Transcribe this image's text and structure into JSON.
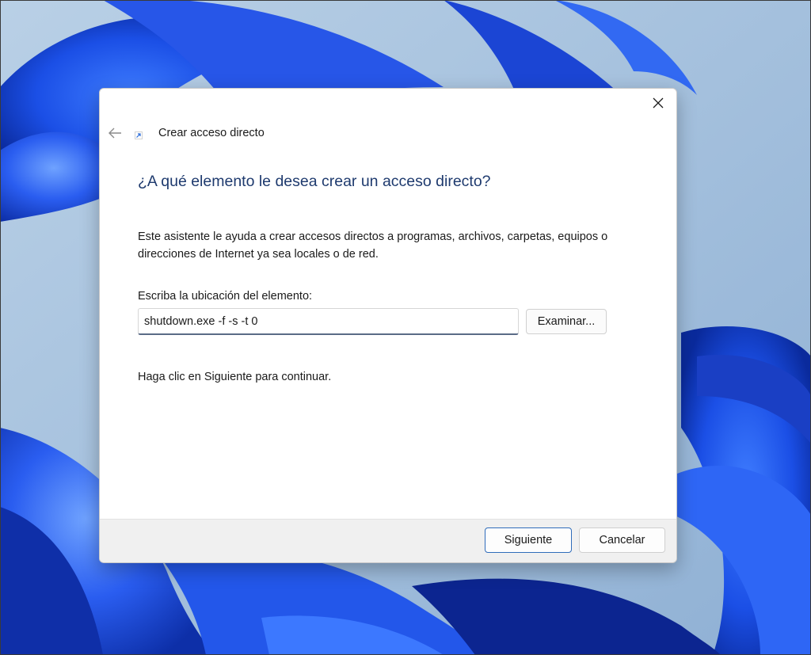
{
  "dialog": {
    "title": "Crear acceso directo",
    "question": "¿A qué elemento le desea crear un acceso directo?",
    "description": "Este asistente le ayuda a crear accesos directos a programas, archivos, carpetas, equipos o direcciones de Internet ya sea locales o de red.",
    "location_label": "Escriba la ubicación del elemento:",
    "location_value": "shutdown.exe -f -s -t 0",
    "browse_label": "Examinar...",
    "continue_text": "Haga clic en Siguiente para continuar.",
    "next_label": "Siguiente",
    "cancel_label": "Cancelar"
  },
  "icons": {
    "close": "close-icon",
    "back": "back-arrow-icon",
    "shortcut": "shortcut-arrow-icon"
  },
  "colors": {
    "question_text": "#1e3a6e",
    "accent": "#2f6cba",
    "wallpaper_blue": "#1a4fe0",
    "footer_bg": "#f0f0f0"
  }
}
